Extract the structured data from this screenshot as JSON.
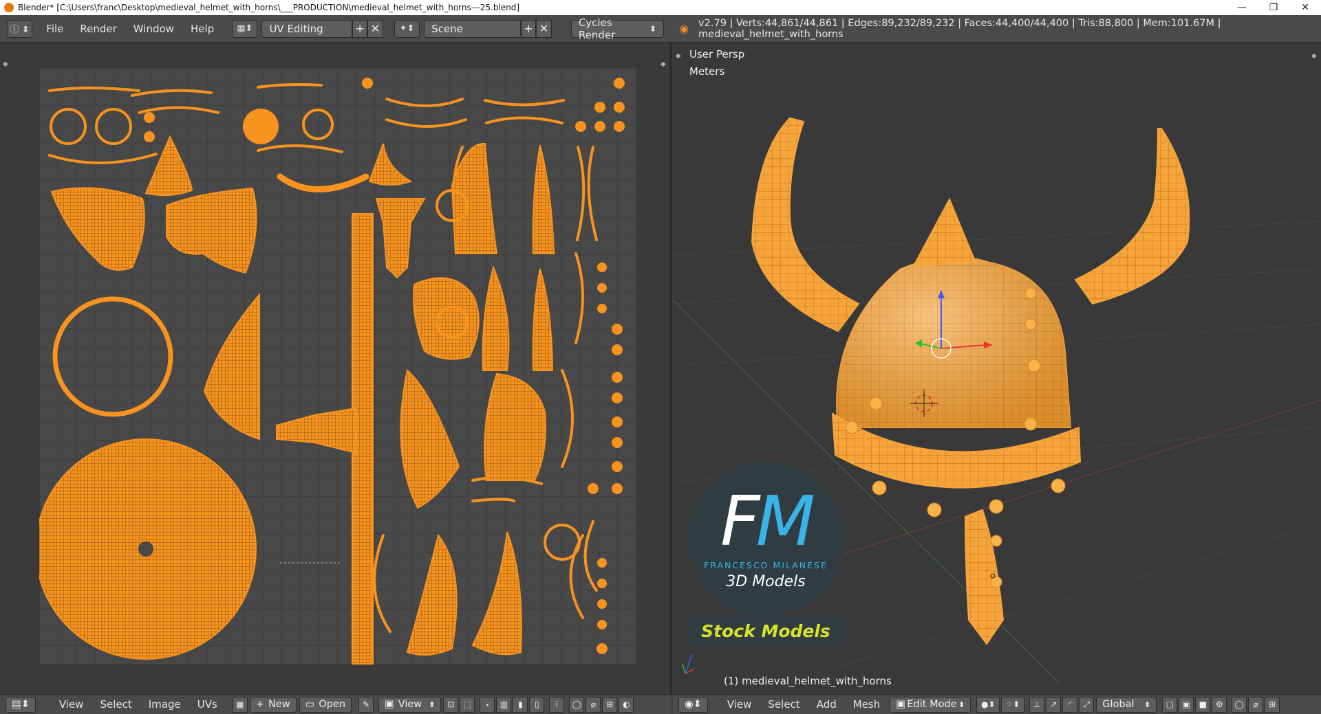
{
  "window": {
    "title": "Blender* [C:\\Users\\franc\\Desktop\\medieval_helmet_with_horns\\___PRODUCTION\\medieval_helmet_with_horns---25.blend]",
    "controls": [
      "—",
      "❐",
      "✕"
    ]
  },
  "info_header": {
    "menus": [
      "File",
      "Render",
      "Window",
      "Help"
    ],
    "screen_layout": "UV Editing",
    "scene": "Scene",
    "render_engine": "Cycles Render",
    "stats": "v2.79 | Verts:44,861/44,861 | Edges:89,232/89,232 | Faces:44,400/44,400 | Tris:88,800 | Mem:101.67M | medieval_helmet_with_horns"
  },
  "viewport": {
    "view_name": "User Persp",
    "units": "Meters",
    "object_label": "(1) medieval_helmet_with_horns",
    "watermark": {
      "brand_initials_f": "F",
      "brand_initials_m": "M",
      "brand_name": "FRANCESCO MILANESE",
      "brand_tagline": "3D Models",
      "banner": "Stock Models"
    }
  },
  "uv_footer": {
    "menus": [
      "View",
      "Select",
      "Image",
      "UVs"
    ],
    "new_label": "New",
    "open_label": "Open",
    "view_label": "View"
  },
  "vp_footer": {
    "menus": [
      "View",
      "Select",
      "Add",
      "Mesh"
    ],
    "mode": "Edit Mode",
    "orientation": "Global"
  },
  "colors": {
    "uv_orange": "#f7931e",
    "mesh_orange": "#f5a43b",
    "header_bg": "#4a4a4a"
  }
}
